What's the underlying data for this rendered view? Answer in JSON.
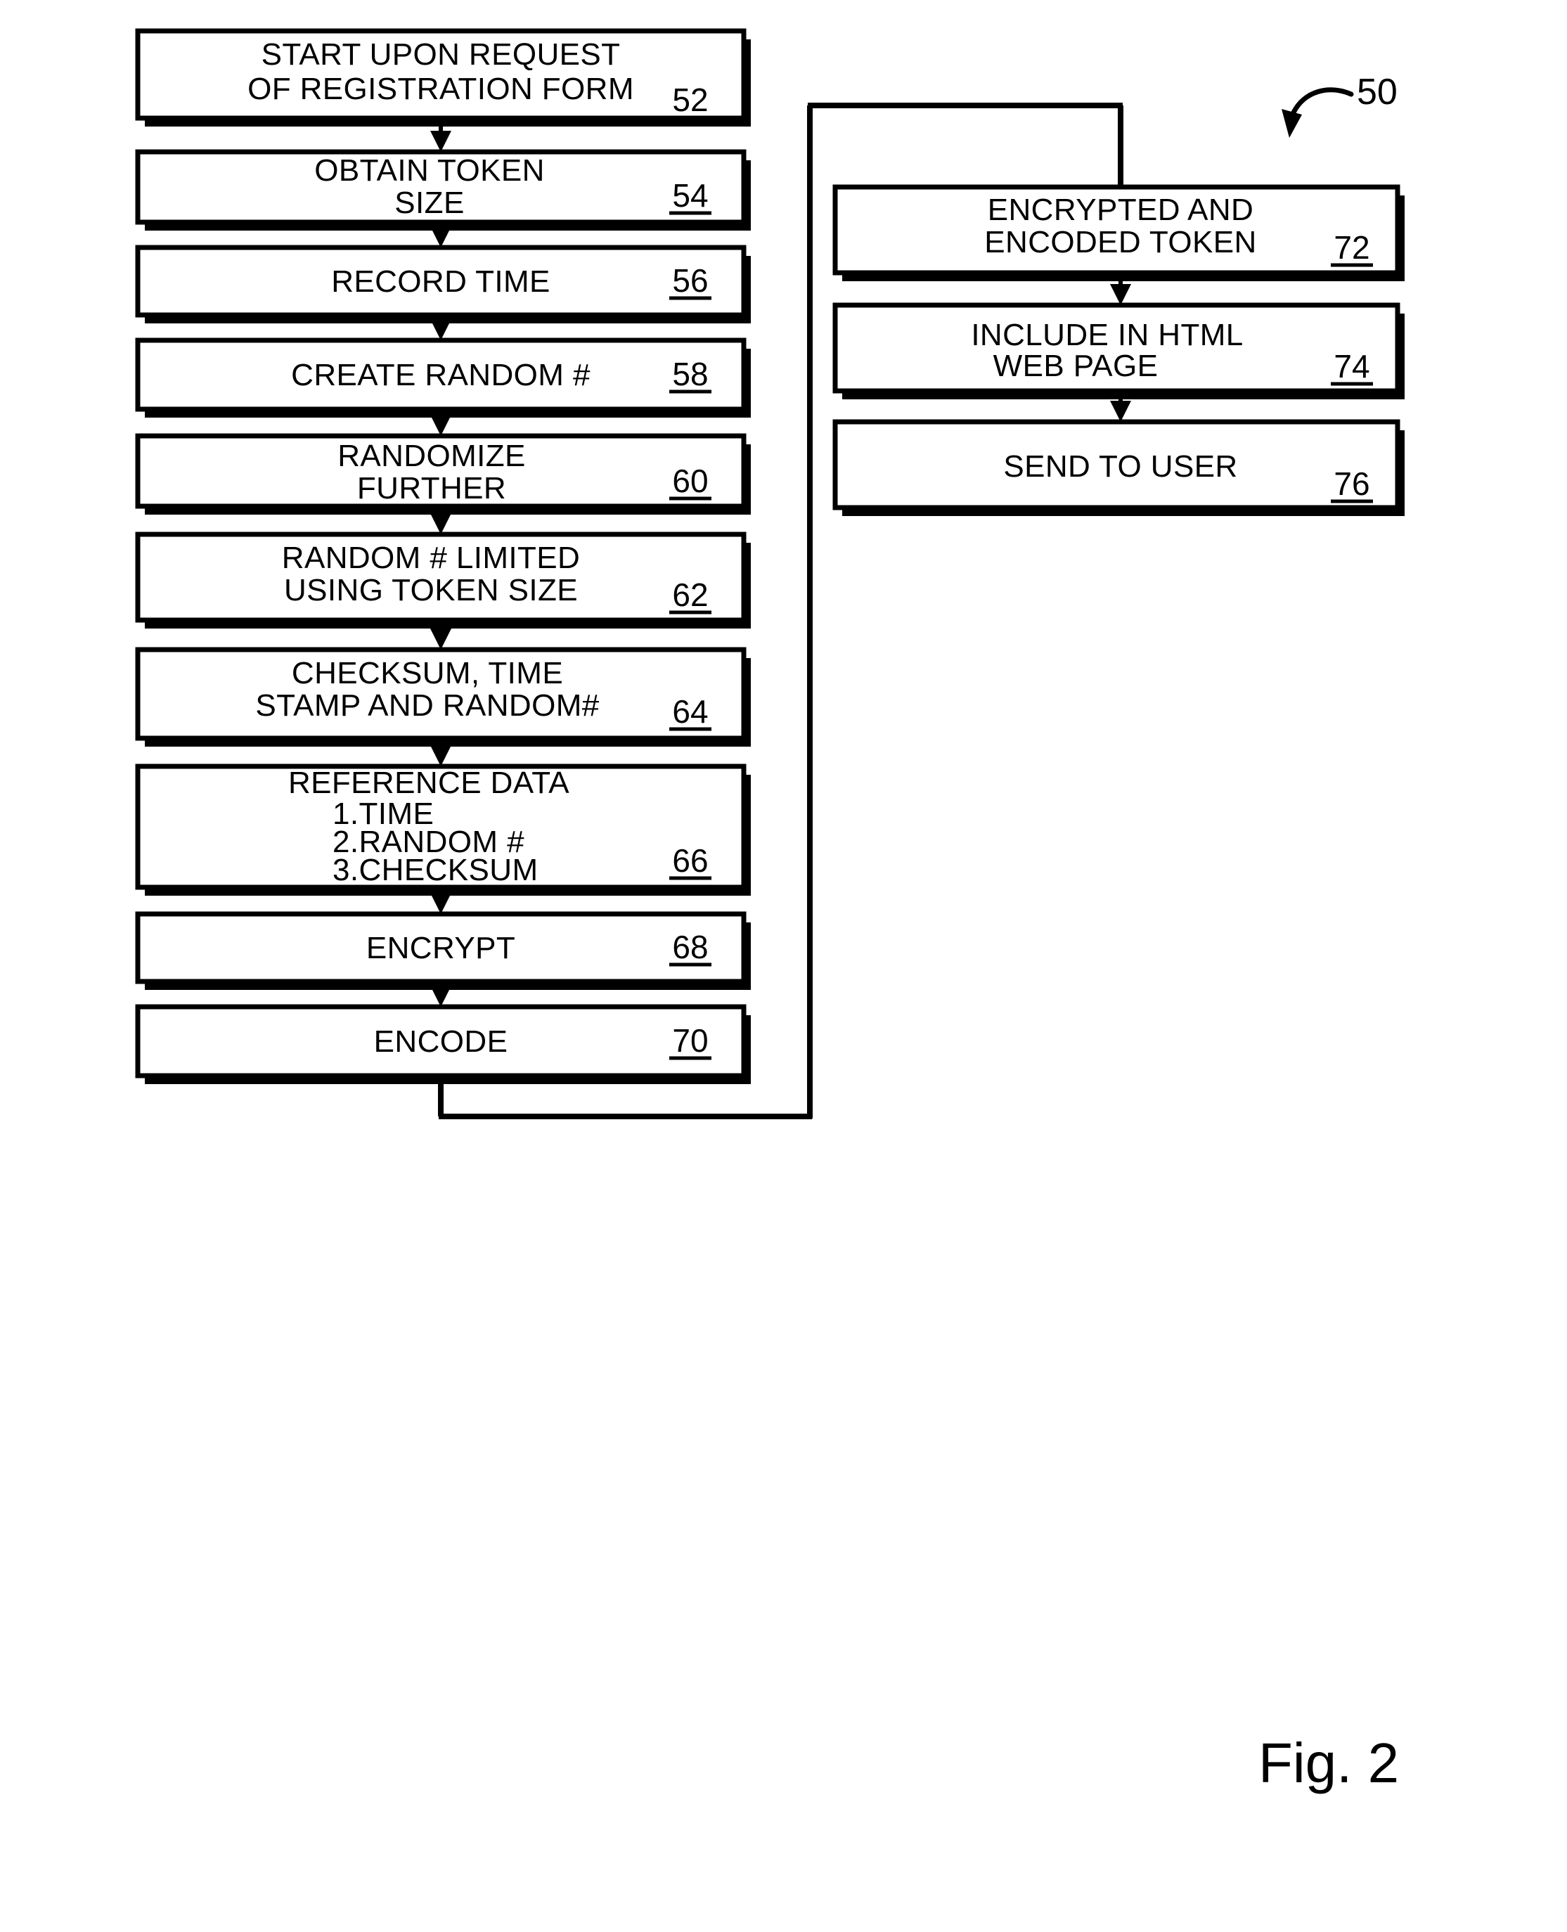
{
  "figure": {
    "caption": "Fig. 2",
    "assembly_reference": "50"
  },
  "flow": {
    "left_column": [
      {
        "id": "52",
        "lines": [
          "START UPON REQUEST",
          "OF REGISTRATION FORM"
        ],
        "ref": "52"
      },
      {
        "id": "54",
        "lines": [
          "OBTAIN TOKEN",
          "SIZE"
        ],
        "ref": "54"
      },
      {
        "id": "56",
        "lines": [
          "RECORD TIME"
        ],
        "ref": "56"
      },
      {
        "id": "58",
        "lines": [
          "CREATE RANDOM #"
        ],
        "ref": "58"
      },
      {
        "id": "60",
        "lines": [
          "RANDOMIZE",
          "FURTHER"
        ],
        "ref": "60"
      },
      {
        "id": "62",
        "lines": [
          "RANDOM # LIMITED",
          "USING TOKEN SIZE"
        ],
        "ref": "62"
      },
      {
        "id": "64",
        "lines": [
          "CHECKSUM, TIME",
          "STAMP AND RANDOM#"
        ],
        "ref": "64"
      },
      {
        "id": "66",
        "lines": [
          "REFERENCE DATA",
          "1.TIME",
          "2.RANDOM #",
          "3.CHECKSUM"
        ],
        "ref": "66"
      },
      {
        "id": "68",
        "lines": [
          "ENCRYPT"
        ],
        "ref": "68"
      },
      {
        "id": "70",
        "lines": [
          "ENCODE"
        ],
        "ref": "70"
      }
    ],
    "right_column": [
      {
        "id": "72",
        "lines": [
          "ENCRYPTED AND",
          "ENCODED TOKEN"
        ],
        "ref": "72"
      },
      {
        "id": "74",
        "lines": [
          "INCLUDE IN HTML",
          "WEB PAGE"
        ],
        "ref": "74"
      },
      {
        "id": "76",
        "lines": [
          "SEND TO USER"
        ],
        "ref": "76"
      }
    ]
  },
  "text": {
    "b52_l1": "START UPON REQUEST",
    "b52_l2": "OF REGISTRATION FORM",
    "b52_ref": "52",
    "b54_l1": "OBTAIN TOKEN",
    "b54_l2": "SIZE",
    "b54_ref": "54",
    "b56_l1": "RECORD TIME",
    "b56_ref": "56",
    "b58_l1": "CREATE RANDOM #",
    "b58_ref": "58",
    "b60_l1": "RANDOMIZE",
    "b60_l2": "FURTHER",
    "b60_ref": "60",
    "b62_l1": "RANDOM # LIMITED",
    "b62_l2": "USING TOKEN SIZE",
    "b62_ref": "62",
    "b64_l1": "CHECKSUM, TIME",
    "b64_l2": "STAMP AND RANDOM#",
    "b64_ref": "64",
    "b66_l1": "REFERENCE DATA",
    "b66_l2": "1.TIME",
    "b66_l3": "2.RANDOM #",
    "b66_l4": "3.CHECKSUM",
    "b66_ref": "66",
    "b68_l1": "ENCRYPT",
    "b68_ref": "68",
    "b70_l1": "ENCODE",
    "b70_ref": "70",
    "b72_l1": "ENCRYPTED AND",
    "b72_l2": "ENCODED TOKEN",
    "b72_ref": "72",
    "b74_l1": "INCLUDE IN HTML",
    "b74_l2": "WEB PAGE",
    "b74_ref": "74",
    "b76_l1": "SEND TO USER",
    "b76_ref": "76",
    "fig_caption": "Fig. 2",
    "assembly_num": "50"
  },
  "colors": {
    "ink": "#000000",
    "paper": "#ffffff"
  }
}
